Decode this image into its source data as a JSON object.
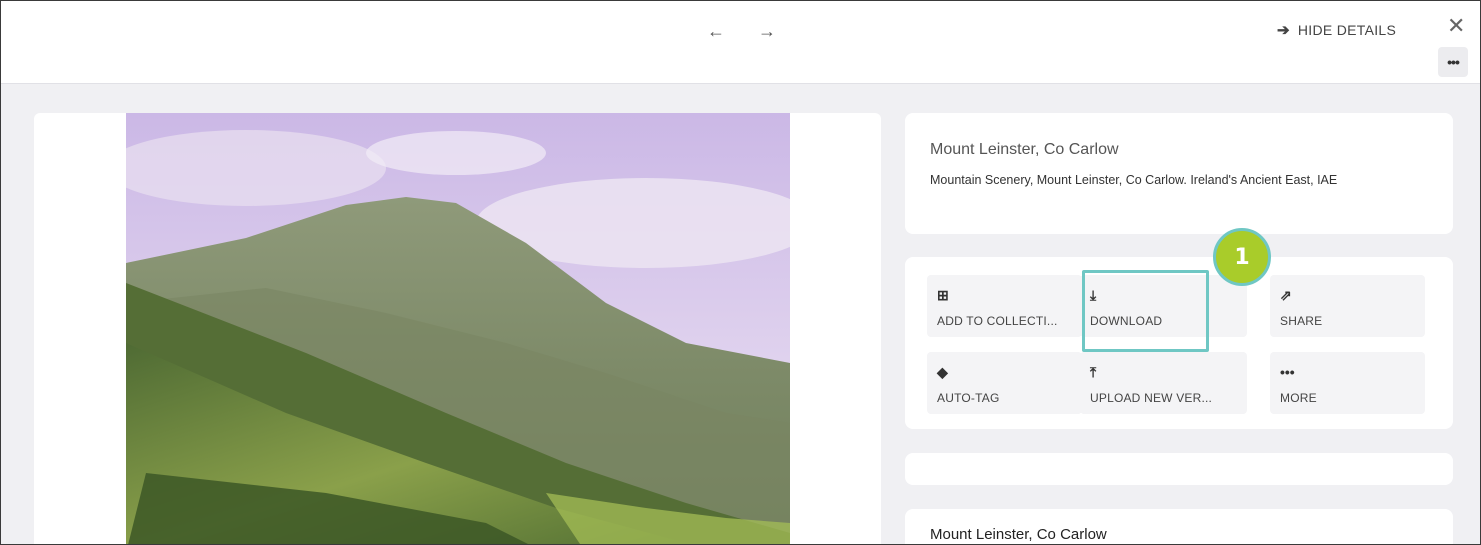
{
  "toolbar": {
    "prev_arrow": "←",
    "next_arrow": "→",
    "hide_details_arrow": "➔",
    "hide_details_label": "HIDE DETAILS",
    "close_glyph": "✕",
    "more_glyph": "•••"
  },
  "asset": {
    "title": "Mount Leinster, Co Carlow",
    "description": "Mountain Scenery, Mount Leinster, Co Carlow. Ireland's Ancient East, IAE"
  },
  "actions": [
    {
      "icon": "plus-square-icon",
      "glyph": "⊞",
      "label": "ADD TO COLLECTI..."
    },
    {
      "icon": "download-icon",
      "glyph": "⤓",
      "label": "DOWNLOAD"
    },
    {
      "icon": "share-icon",
      "glyph": "⇗",
      "label": "SHARE"
    },
    {
      "icon": "tags-icon",
      "glyph": "◆",
      "label": "AUTO-TAG"
    },
    {
      "icon": "upload-icon",
      "glyph": "⤒",
      "label": "UPLOAD NEW VER..."
    },
    {
      "icon": "more-icon",
      "glyph": "•••",
      "label": "MORE"
    }
  ],
  "annotation": {
    "step_number": "1",
    "highlight_color": "#6fc7c4",
    "badge_color": "#a9cc2a"
  },
  "metadata": {
    "title": "Mount Leinster, Co Carlow"
  }
}
